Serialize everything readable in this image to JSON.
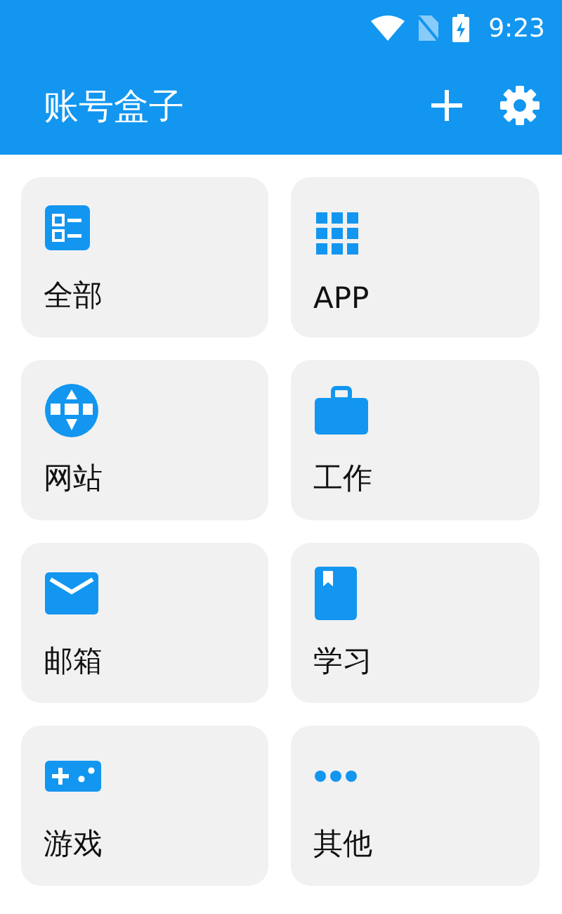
{
  "status_bar": {
    "time": "9:23"
  },
  "app_bar": {
    "title": "账号盒子"
  },
  "categories": [
    {
      "kind": "list",
      "label": "全部"
    },
    {
      "kind": "grid",
      "label": "APP"
    },
    {
      "kind": "globe",
      "label": "网站"
    },
    {
      "kind": "briefcase",
      "label": "工作"
    },
    {
      "kind": "mail",
      "label": "邮箱"
    },
    {
      "kind": "book",
      "label": "学习"
    },
    {
      "kind": "gamepad",
      "label": "游戏"
    },
    {
      "kind": "more",
      "label": "其他"
    }
  ]
}
